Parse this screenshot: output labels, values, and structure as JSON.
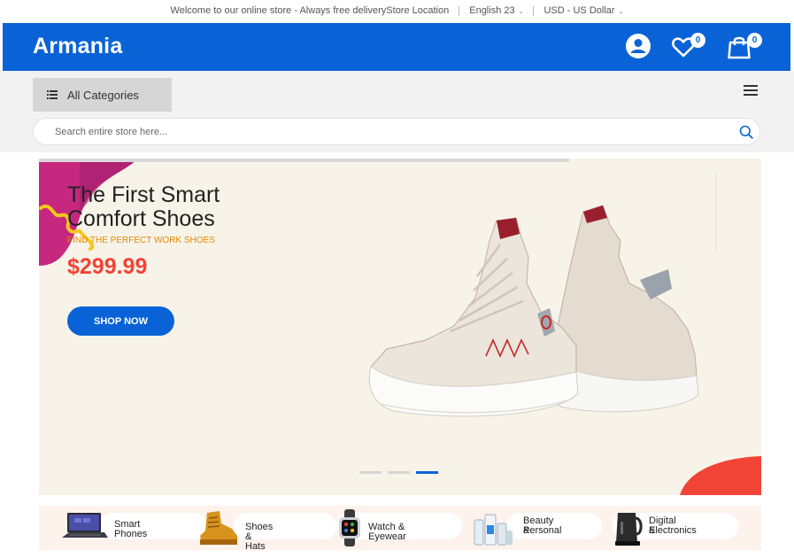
{
  "topbar": {
    "welcome": "Welcome to our online store - Always free delivery",
    "store_location": "Store Location",
    "language": "English 23",
    "currency": "USD - US Dollar"
  },
  "header": {
    "logo": "Armania",
    "wishlist_count": "0",
    "cart_count": "0",
    "brand_color": "#0a63d6"
  },
  "nav": {
    "all_categories": "All Categories"
  },
  "search": {
    "placeholder": "Search entire store here..."
  },
  "banner": {
    "title_line1": "The First Smart",
    "title_line2": "Comfort Shoes",
    "subtitle": "FIND THE PERFECT WORK SHOES",
    "price": "$299.99",
    "cta": "SHOP NOW",
    "slide_count": 3,
    "active_slide": 3
  },
  "categories": [
    {
      "label_line1": "Smart Phones",
      "label_line2": ""
    },
    {
      "label_line1": "Shoes & Hats",
      "label_line2": ""
    },
    {
      "label_line1": "Watch & Eyewear",
      "label_line2": ""
    },
    {
      "label_line1": "Beauty &",
      "label_line2": "Personal"
    },
    {
      "label_line1": "Digital &",
      "label_line2": "Electronics"
    }
  ],
  "icons": {
    "account": "user-icon",
    "wishlist": "heart-icon",
    "cart": "shopping-bag-icon",
    "search": "search-icon",
    "menu": "hamburger-icon",
    "categories": "list-icon"
  }
}
